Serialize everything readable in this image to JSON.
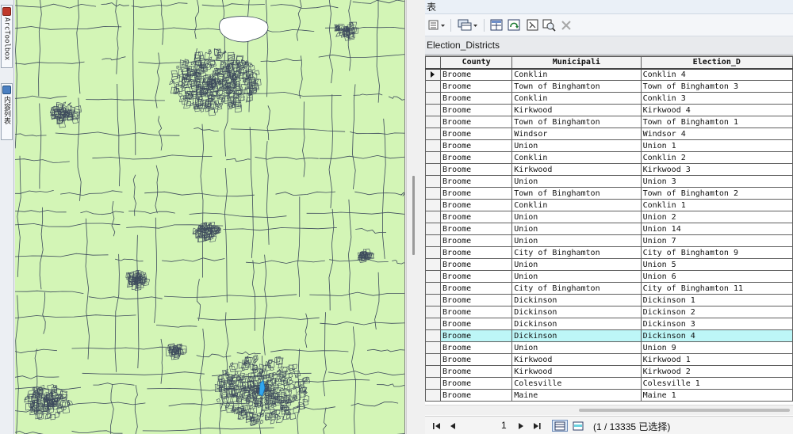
{
  "dock": {
    "arctoolbox_label": "ArcToolbox",
    "toc_label": "内容列表"
  },
  "table_window": {
    "title": "表",
    "layer_name": "Election_Districts"
  },
  "toolbar": {
    "icons": [
      "table-options-icon",
      "related-tables-icon",
      "select-by-attributes-icon",
      "switch-selection-icon",
      "clear-selection-icon",
      "zoom-to-selected-icon",
      "delete-selected-icon"
    ]
  },
  "grid": {
    "columns": [
      "County",
      "Municipali",
      "Election_D"
    ],
    "highlighted_row": 22,
    "rows": [
      [
        "Broome",
        "Conklin",
        "Conklin 4"
      ],
      [
        "Broome",
        "Town of Binghamton",
        "Town of Binghamton 3"
      ],
      [
        "Broome",
        "Conklin",
        "Conklin 3"
      ],
      [
        "Broome",
        "Kirkwood",
        "Kirkwood 4"
      ],
      [
        "Broome",
        "Town of Binghamton",
        "Town of Binghamton 1"
      ],
      [
        "Broome",
        "Windsor",
        "Windsor 4"
      ],
      [
        "Broome",
        "Union",
        "Union 1"
      ],
      [
        "Broome",
        "Conklin",
        "Conklin 2"
      ],
      [
        "Broome",
        "Kirkwood",
        "Kirkwood 3"
      ],
      [
        "Broome",
        "Union",
        "Union 3"
      ],
      [
        "Broome",
        "Town of Binghamton",
        "Town of Binghamton 2"
      ],
      [
        "Broome",
        "Conklin",
        "Conklin 1"
      ],
      [
        "Broome",
        "Union",
        "Union 2"
      ],
      [
        "Broome",
        "Union",
        "Union 14"
      ],
      [
        "Broome",
        "Union",
        "Union 7"
      ],
      [
        "Broome",
        "City of Binghamton",
        "City of Binghamton 9"
      ],
      [
        "Broome",
        "Union",
        "Union 5"
      ],
      [
        "Broome",
        "Union",
        "Union 6"
      ],
      [
        "Broome",
        "City of Binghamton",
        "City of Binghamton 11"
      ],
      [
        "Broome",
        "Dickinson",
        "Dickinson 1"
      ],
      [
        "Broome",
        "Dickinson",
        "Dickinson 2"
      ],
      [
        "Broome",
        "Dickinson",
        "Dickinson 3"
      ],
      [
        "Broome",
        "Dickinson",
        "Dickinson 4"
      ],
      [
        "Broome",
        "Union",
        "Union 9"
      ],
      [
        "Broome",
        "Kirkwood",
        "Kirkwood 1"
      ],
      [
        "Broome",
        "Kirkwood",
        "Kirkwood 2"
      ],
      [
        "Broome",
        "Colesville",
        "Colesville 1"
      ],
      [
        "Broome",
        "Maine",
        "Maine 1"
      ]
    ]
  },
  "status": {
    "current_page": "1",
    "selection_text": "(1 / 13335 已选择)"
  },
  "colors": {
    "map_fill": "#d3f5b6",
    "boundary": "#3d4a5c",
    "water": "#ffffff",
    "highlight_row": "#bdf6f7"
  }
}
